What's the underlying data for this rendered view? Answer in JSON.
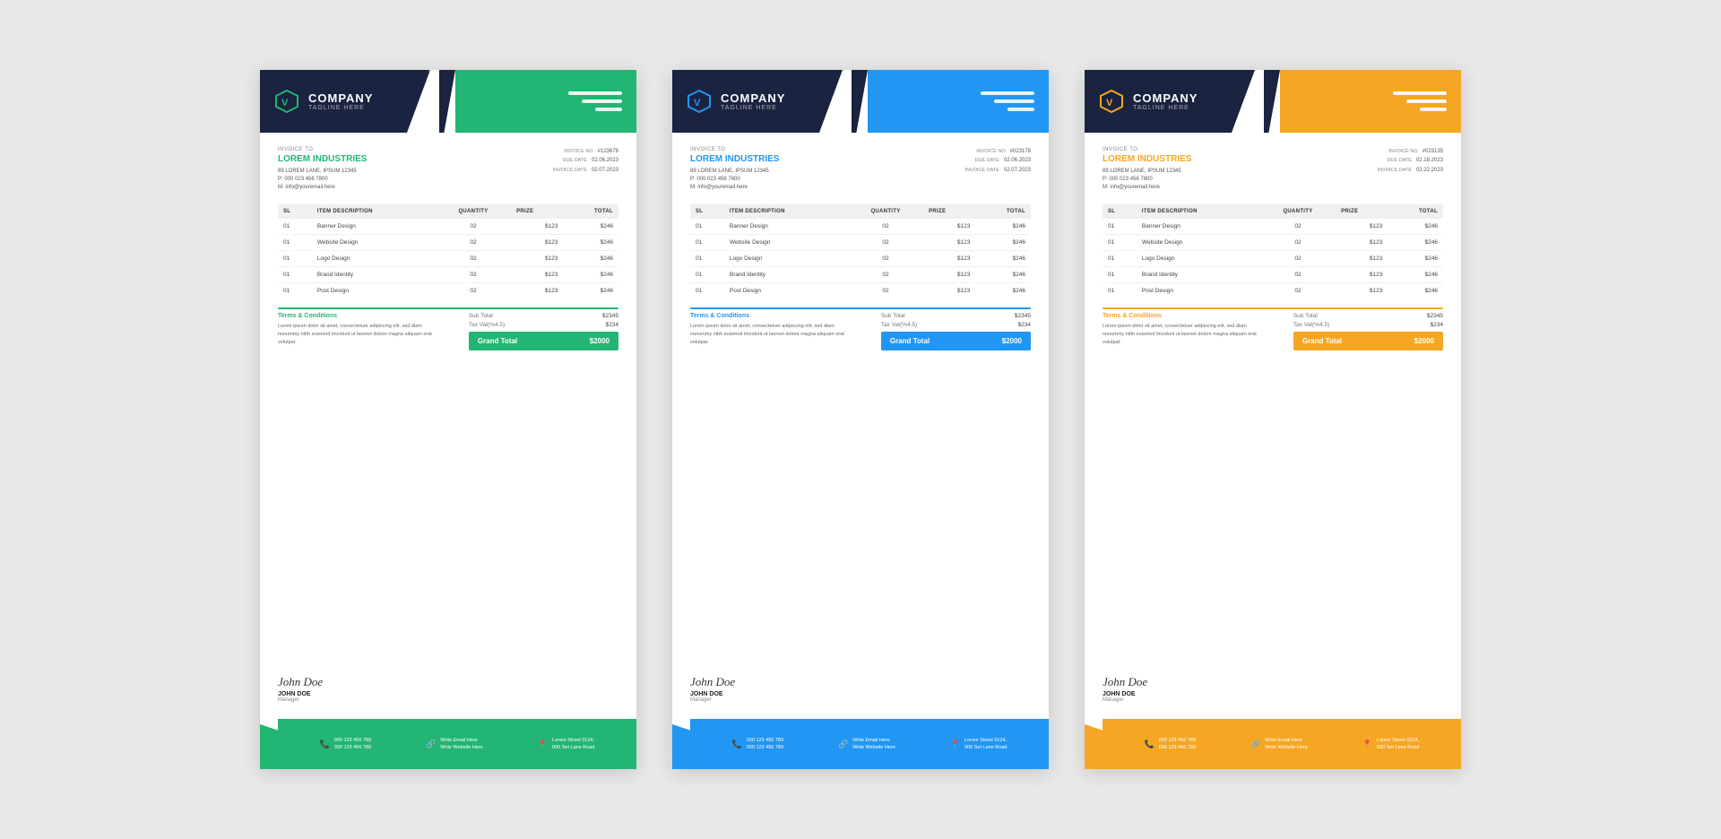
{
  "invoices": [
    {
      "variant": "green",
      "accentColor": "#22b573",
      "company": {
        "name": "COMPANY",
        "tagline": "TAGLINE HERE"
      },
      "invoiceTo": {
        "label": "INVOICE TO",
        "clientName": "LOREM INDUSTRIES",
        "address": "89 LOREM LANE, IPSUM 12345",
        "phone": "P: 000 023 456 7800",
        "mobile": "M: info@youremail.here"
      },
      "meta": {
        "invoiceNoLabel": "INVOICE NO",
        "invoiceNo": "#123678",
        "dueDateLabel": "DUE DATE",
        "dueDate": "02.06.2023",
        "invoiceDateLabel": "INVOICE DATE",
        "invoiceDate": "02.07.2023"
      },
      "tableHeaders": [
        "SL",
        "ITEM DESCRIPTION",
        "QUANTITY",
        "PRIZE",
        "TOTAL"
      ],
      "items": [
        {
          "sl": "01",
          "desc": "Banner Design",
          "qty": "02",
          "price": "$123",
          "total": "$246"
        },
        {
          "sl": "01",
          "desc": "Website Design",
          "qty": "02",
          "price": "$123",
          "total": "$246"
        },
        {
          "sl": "01",
          "desc": "Logo Design",
          "qty": "02",
          "price": "$123",
          "total": "$246"
        },
        {
          "sl": "01",
          "desc": "Brand Identity",
          "qty": "02",
          "price": "$123",
          "total": "$246"
        },
        {
          "sl": "01",
          "desc": "Post Design",
          "qty": "02",
          "price": "$123",
          "total": "$246"
        }
      ],
      "subTotal": "$2345",
      "taxLabel": "Tax Vat(%4.5)",
      "tax": "$234",
      "grandTotal": "$2000",
      "grandTotalLabel": "Grand Total",
      "termsTitle": "Terms & Conditions",
      "termsText": "Lorem ipsum dolor sit amet, consectetuer adipiscing elit, sed diam nonummy nibh euismod tincidunt ut laoreet dolore magna aliquam erat volutpat.",
      "signature": "John Doe",
      "signerName": "JOHN DOE",
      "signerTitle": "Manager",
      "footer": {
        "phone1": "000 123 456 789",
        "phone2": "000 123 456 789",
        "email": "Write Email Here",
        "website": "Write Website Here",
        "address": "Lorem Street 0124,",
        "address2": "000 Set Lane Road"
      }
    },
    {
      "variant": "blue",
      "accentColor": "#2196f3",
      "company": {
        "name": "COMPANY",
        "tagline": "TAGLINE HERE"
      },
      "invoiceTo": {
        "label": "INVOICE TO",
        "clientName": "LOREM INDUSTRIES",
        "address": "89 LOREM LANE, IPSUM 12345",
        "phone": "P: 000 023 456 7800",
        "mobile": "M: info@youremail.here"
      },
      "meta": {
        "invoiceNoLabel": "INVOICE NO",
        "invoiceNo": "#023178",
        "dueDateLabel": "DUE DATE",
        "dueDate": "02.06.2023",
        "invoiceDateLabel": "INVOICE DATE",
        "invoiceDate": "02.07.2023"
      },
      "tableHeaders": [
        "SL",
        "ITEM DESCRIPTION",
        "QUANTITY",
        "PRIZE",
        "TOTAL"
      ],
      "items": [
        {
          "sl": "01",
          "desc": "Banner Design",
          "qty": "02",
          "price": "$123",
          "total": "$246"
        },
        {
          "sl": "01",
          "desc": "Website Design",
          "qty": "02",
          "price": "$123",
          "total": "$246"
        },
        {
          "sl": "01",
          "desc": "Logo Design",
          "qty": "02",
          "price": "$123",
          "total": "$246"
        },
        {
          "sl": "01",
          "desc": "Brand Identity",
          "qty": "02",
          "price": "$123",
          "total": "$246"
        },
        {
          "sl": "01",
          "desc": "Post Design",
          "qty": "02",
          "price": "$123",
          "total": "$246"
        }
      ],
      "subTotal": "$2345",
      "taxLabel": "Tax Vat(%4.5)",
      "tax": "$234",
      "grandTotal": "$2000",
      "grandTotalLabel": "Grand Total",
      "termsTitle": "Terms & Conditions",
      "termsText": "Lorem ipsum dolor sit amet, consectetuer adipiscing elit, sed diam nonummy nibh euismod tincidunt ut laoreet dolore magna aliquam erat volutpat.",
      "signature": "John Doe",
      "signerName": "JOHN DOE",
      "signerTitle": "Manager",
      "footer": {
        "phone1": "000 123 456 789",
        "phone2": "000 123 456 789",
        "email": "Write Email Here",
        "website": "Write Website Here",
        "address": "Lorem Street 0124,",
        "address2": "000 Set Lane Road"
      }
    },
    {
      "variant": "orange",
      "accentColor": "#f5a623",
      "company": {
        "name": "COMPANY",
        "tagline": "TAGLINE HERE"
      },
      "invoiceTo": {
        "label": "INVOICE TO",
        "clientName": "LOREM INDUSTRIES",
        "address": "89 LOREM LANE, IPSUM 12345",
        "phone": "P: 000 023 456 7800",
        "mobile": "M: info@youremail.here"
      },
      "meta": {
        "invoiceNoLabel": "INVOICE NO",
        "invoiceNo": "#023135",
        "dueDateLabel": "DUE DATE",
        "dueDate": "02.18.2023",
        "invoiceDateLabel": "INVOICE DATE",
        "invoiceDate": "02.22.2023"
      },
      "tableHeaders": [
        "SL",
        "ITEM DESCRIPTION",
        "QUANTITY",
        "PRIZE",
        "TOTAL"
      ],
      "items": [
        {
          "sl": "01",
          "desc": "Banner Design",
          "qty": "02",
          "price": "$123",
          "total": "$246"
        },
        {
          "sl": "01",
          "desc": "Website Design",
          "qty": "02",
          "price": "$123",
          "total": "$246"
        },
        {
          "sl": "01",
          "desc": "Logo Design",
          "qty": "02",
          "price": "$123",
          "total": "$246"
        },
        {
          "sl": "01",
          "desc": "Brand Identity",
          "qty": "02",
          "price": "$123",
          "total": "$246"
        },
        {
          "sl": "01",
          "desc": "Post Design",
          "qty": "02",
          "price": "$123",
          "total": "$246"
        }
      ],
      "subTotal": "$2345",
      "taxLabel": "Tax Vat(%4.5)",
      "tax": "$234",
      "grandTotal": "$2000",
      "grandTotalLabel": "Grand Total",
      "termsTitle": "Terms & Conditions",
      "termsText": "Lorem ipsum dolor sit amet, consectetuer adipiscing elit, sed diam nonummy nibh euismod tincidunt ut laoreet dolore magna aliquam erat volutpat.",
      "signature": "John Doe",
      "signerName": "JOHN DOE",
      "signerTitle": "Manager",
      "footer": {
        "phone1": "000 123 456 789",
        "phone2": "000 123 456 789",
        "email": "Write Email Here",
        "website": "Write Website Here",
        "address": "Lorem Street 0124,",
        "address2": "000 Set Lane Road"
      }
    }
  ]
}
